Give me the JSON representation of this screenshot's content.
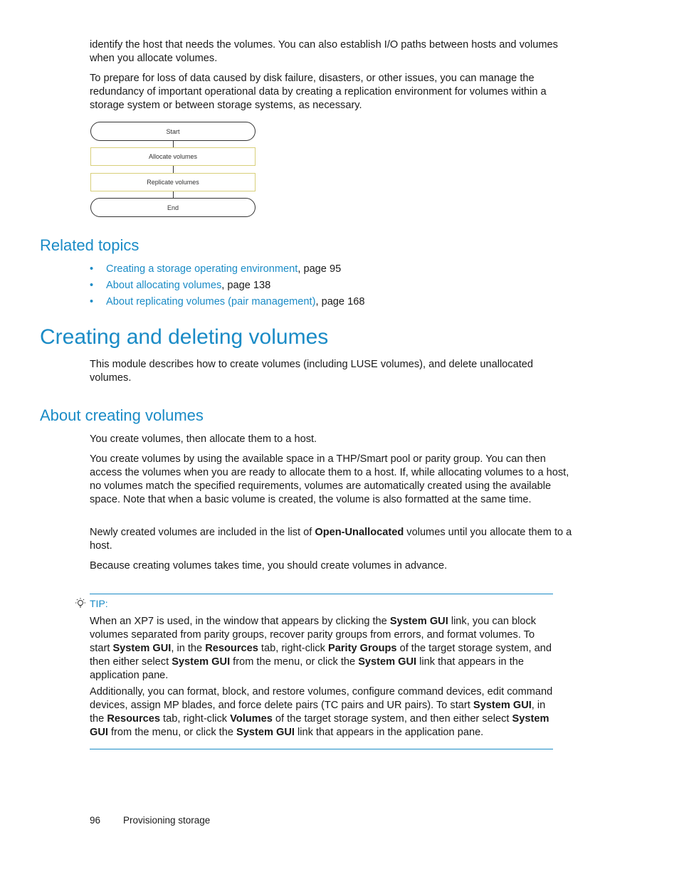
{
  "intro": {
    "p1": "identify the host that needs the volumes. You can also establish I/O paths between hosts and volumes when you allocate volumes.",
    "p2": "To prepare for loss of data caused by disk failure, disasters, or other issues, you can manage the redundancy of important operational data by creating a replication environment for volumes within a storage system or between storage systems, as necessary."
  },
  "flowchart": {
    "nodes": [
      "Start",
      "Allocate volumes",
      "Replicate volumes",
      "End"
    ]
  },
  "related_topics": {
    "heading": "Related topics",
    "items": [
      {
        "link": "Creating a storage operating environment",
        "suffix": ", page 95"
      },
      {
        "link": "About allocating volumes",
        "suffix": ", page 138"
      },
      {
        "link": "About replicating volumes (pair management)",
        "suffix": ", page 168"
      }
    ]
  },
  "section": {
    "title": "Creating and deleting volumes",
    "intro": "This module describes how to create volumes (including LUSE volumes), and delete unallocated volumes."
  },
  "subsection": {
    "title": "About creating volumes",
    "p1": "You create volumes, then allocate them to a host.",
    "p2": "You create volumes by using the available space in a THP/Smart pool or parity group. You can then access the volumes when you are ready to allocate them to a host. If, while allocating volumes to a host, no volumes match the specified requirements, volumes are automatically created using the available space. Note that when a basic volume is created, the volume is also formatted at the same time.",
    "p3_pre": "Newly created volumes are included in the list of ",
    "p3_bold": "Open-Unallocated",
    "p3_post": " volumes until you allocate them to a host.",
    "p4": "Because creating volumes takes time, you should create volumes in advance."
  },
  "tip": {
    "icon": "lightbulb-icon",
    "label": "TIP:",
    "para1": [
      {
        "t": "When an XP7 is used, in the window that appears by clicking the "
      },
      {
        "b": "System GUI"
      },
      {
        "t": " link, you can block volumes separated from parity groups, recover parity groups from errors, and format volumes. To start "
      },
      {
        "b": "System GUI"
      },
      {
        "t": ", in the "
      },
      {
        "b": "Resources"
      },
      {
        "t": " tab, right-click "
      },
      {
        "b": "Parity Groups"
      },
      {
        "t": " of the target storage system, and then either select "
      },
      {
        "b": "System GUI"
      },
      {
        "t": " from the menu, or click the "
      },
      {
        "b": "System GUI"
      },
      {
        "t": " link that appears in the application pane."
      }
    ],
    "para2": [
      {
        "t": "Additionally, you can format, block, and restore volumes, configure command devices, edit command devices, assign MP blades, and force delete pairs (TC pairs and UR pairs). To start "
      },
      {
        "b": "System GUI"
      },
      {
        "t": ", in the "
      },
      {
        "b": "Resources"
      },
      {
        "t": " tab, right-click "
      },
      {
        "b": "Volumes"
      },
      {
        "t": " of the target storage system, and then either select "
      },
      {
        "b": "System GUI"
      },
      {
        "t": " from the menu, or click the "
      },
      {
        "b": "System GUI"
      },
      {
        "t": " link that appears in the application pane."
      }
    ]
  },
  "footer": {
    "page_number": "96",
    "chapter": "Provisioning storage"
  },
  "colors": {
    "accent": "#1a8bc6",
    "process_border": "#d8cf7a"
  }
}
